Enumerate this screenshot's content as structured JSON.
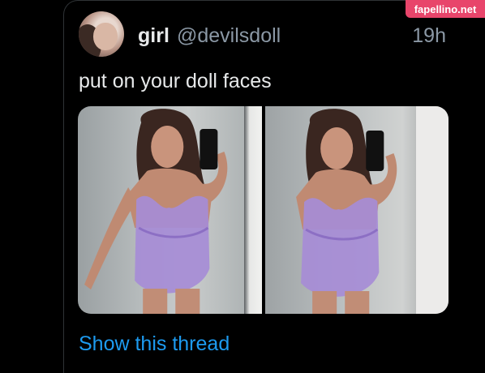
{
  "tweet": {
    "display_name": "girl",
    "handle": "@devilsdoll",
    "timestamp": "19h",
    "text": "put on your doll faces",
    "show_thread_label": "Show this thread"
  },
  "watermark": "fapellino.net",
  "colors": {
    "background": "#000000",
    "text_primary": "#e7e9ea",
    "text_secondary": "#8b98a5",
    "link": "#1d9bf0",
    "watermark_bg": "#e8456b",
    "outfit": "#a68cd6"
  },
  "media": {
    "photo_count": 2
  }
}
